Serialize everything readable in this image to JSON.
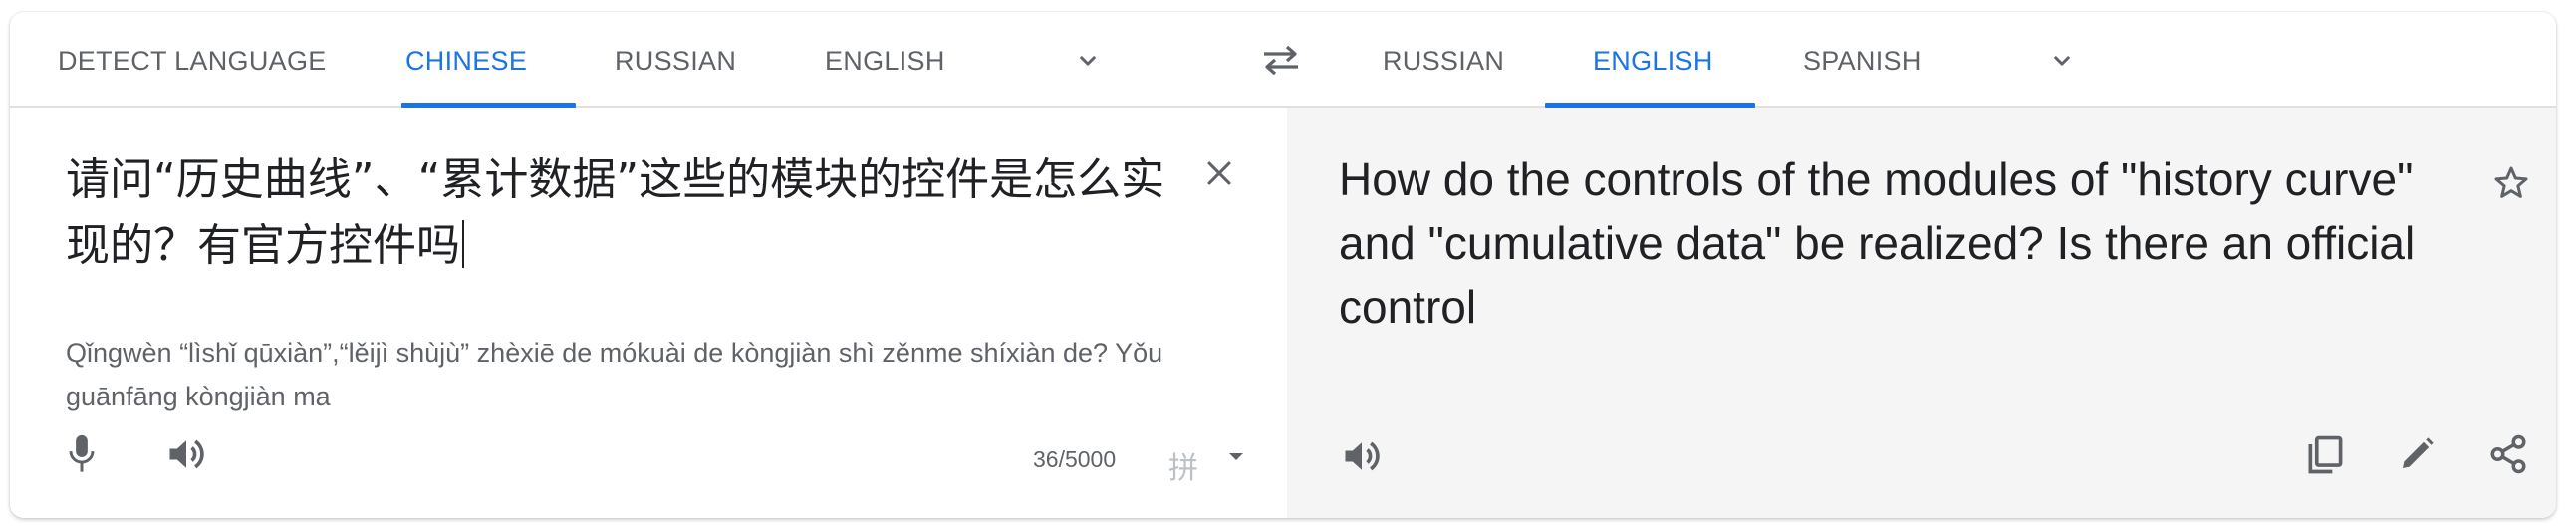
{
  "source_languages": {
    "tabs": [
      {
        "label": "DETECT LANGUAGE",
        "active": false
      },
      {
        "label": "CHINESE",
        "active": true
      },
      {
        "label": "RUSSIAN",
        "active": false
      },
      {
        "label": "ENGLISH",
        "active": false
      }
    ],
    "more_icon": "chevron-down-icon"
  },
  "swap_icon": "swap-icon",
  "target_languages": {
    "tabs": [
      {
        "label": "RUSSIAN",
        "active": false
      },
      {
        "label": "ENGLISH",
        "active": true
      },
      {
        "label": "SPANISH",
        "active": false
      }
    ],
    "more_icon": "chevron-down-icon"
  },
  "source": {
    "text": "请问“历史曲线”、“累计数据”这些的模块的控件是怎么实现的？有官方控件吗",
    "romanization": "Qǐngwèn “lìshǐ qūxiàn”,“lěijì shùjù” zhèxiē de mókuài de kòngjiàn shì zěnme shíxiàn de? Yǒu guānfāng kòngjiàn ma",
    "char_count": "36/5000",
    "ime_label": "拼",
    "icons": [
      "close-icon",
      "microphone-icon",
      "speaker-icon",
      "chevron-down-icon"
    ]
  },
  "translation": {
    "text": "How do the controls of the modules of \"history curve\" and \"cumulative data\" be realized? Is there an official control",
    "icons": [
      "star-icon",
      "speaker-icon",
      "copy-icon",
      "edit-icon",
      "share-icon"
    ]
  },
  "colors": {
    "accent": "#1a73e8",
    "text_primary": "#202124",
    "text_secondary": "#5f6368",
    "translation_bg": "#f5f5f5"
  }
}
